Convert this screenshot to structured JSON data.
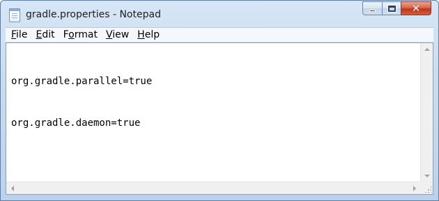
{
  "window": {
    "title": "gradle.properties - Notepad",
    "icon": "notepad-icon",
    "controls": {
      "minimize_icon": "minimize-icon",
      "maximize_icon": "maximize-icon",
      "close_glyph": "✕"
    }
  },
  "menu": {
    "items": [
      {
        "mnemonic": "F",
        "rest": "ile"
      },
      {
        "mnemonic": "E",
        "rest": "dit"
      },
      {
        "pre": "F",
        "mnemonic": "o",
        "rest": "rmat"
      },
      {
        "mnemonic": "V",
        "rest": "iew"
      },
      {
        "mnemonic": "H",
        "rest": "elp"
      }
    ]
  },
  "editor": {
    "lines": [
      "org.gradle.parallel=true",
      "org.gradle.daemon=true"
    ]
  },
  "colors": {
    "frame": "#c9dcf0",
    "close_button": "#c0361c",
    "editor_background": "#ffffff"
  }
}
